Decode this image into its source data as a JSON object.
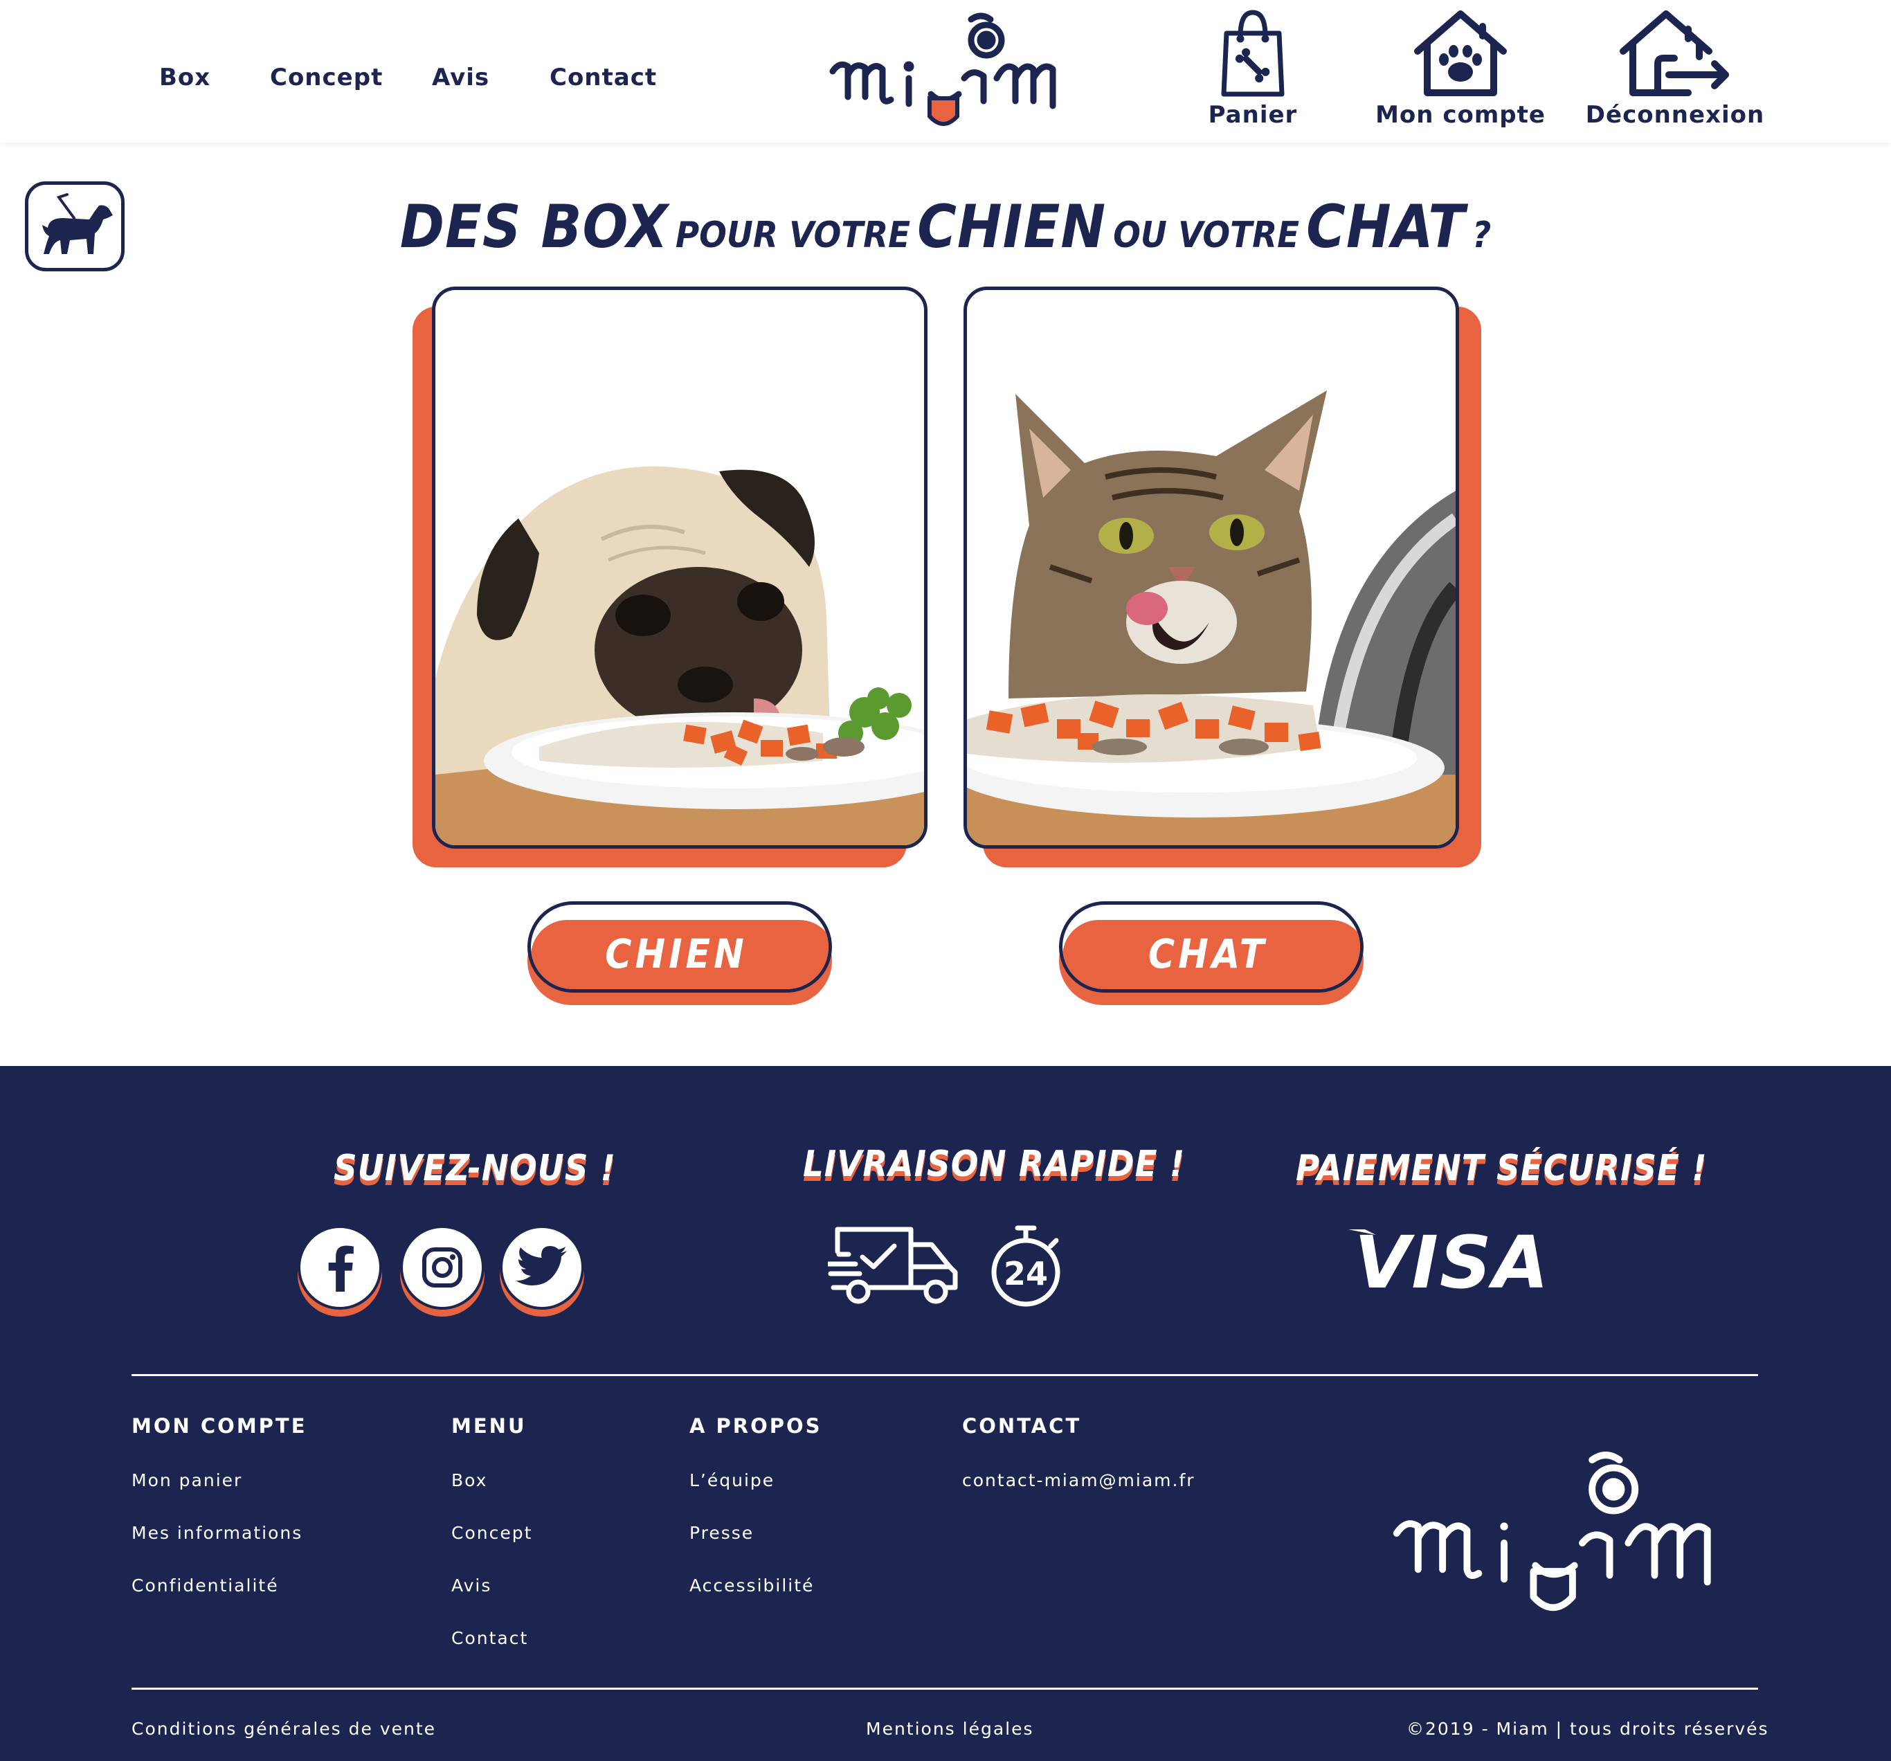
{
  "header": {
    "nav": [
      {
        "label": "Box"
      },
      {
        "label": "Concept"
      },
      {
        "label": "Avis"
      },
      {
        "label": "Contact"
      }
    ],
    "logo_icon": "miam-logo",
    "actions": [
      {
        "label": "Panier",
        "icon": "shopping-bag-bone-icon"
      },
      {
        "label": "Mon compte",
        "icon": "house-paw-icon"
      },
      {
        "label": "Déconnexion",
        "icon": "house-exit-icon"
      }
    ]
  },
  "accessibility": {
    "icon": "guide-dog-icon"
  },
  "main": {
    "title": {
      "part1": "DES BOX",
      "part2": "POUR VOTRE",
      "part3": "CHIEN",
      "part4": "OU VOTRE",
      "part5": "CHAT",
      "part6": "?"
    },
    "cards": [
      {
        "image": "pug-eating-plate",
        "button": "CHIEN"
      },
      {
        "image": "cat-licking-plate",
        "button": "CHAT"
      }
    ]
  },
  "footer": {
    "follow": {
      "title": "SUIVEZ-NOUS !",
      "icons": [
        "facebook-icon",
        "instagram-icon",
        "twitter-icon"
      ]
    },
    "delivery": {
      "title": "LIVRAISON RAPIDE !",
      "icons": [
        "delivery-truck-icon",
        "stopwatch-24-icon"
      ],
      "stopwatch_text": "24"
    },
    "payment": {
      "title": "PAIEMENT SÉCURISÉ !",
      "brand": "VISA"
    },
    "columns": [
      {
        "title": "MON COMPTE",
        "links": [
          "Mon panier",
          "Mes informations",
          "Confidentialité"
        ]
      },
      {
        "title": "MENU",
        "links": [
          "Box",
          "Concept",
          "Avis",
          "Contact"
        ]
      },
      {
        "title": "A PROPOS",
        "links": [
          "L’équipe",
          "Presse",
          "Accessibilité"
        ]
      },
      {
        "title": "CONTACT",
        "links": [
          "contact-miam@miam.fr"
        ]
      }
    ],
    "bottom": {
      "cgv": "Conditions générales de vente",
      "mentions": "Mentions légales",
      "copyright": "©2019 - Miam | tous droits réservés"
    }
  },
  "colors": {
    "navy": "#1b2550",
    "orange": "#e8633f",
    "white": "#ffffff"
  }
}
